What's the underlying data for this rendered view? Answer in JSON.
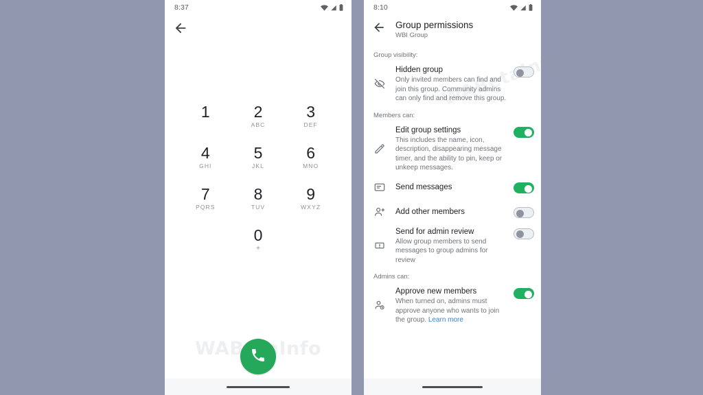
{
  "left_phone": {
    "status_bar": {
      "time": "8:37",
      "icons": [
        "wifi-icon",
        "signal-icon",
        "battery-icon"
      ]
    },
    "back_button": "back-arrow-icon",
    "watermark": "WABetaInfo",
    "keypad": [
      {
        "num": "1",
        "sub": ""
      },
      {
        "num": "2",
        "sub": "ABC"
      },
      {
        "num": "3",
        "sub": "DEF"
      },
      {
        "num": "4",
        "sub": "GHI"
      },
      {
        "num": "5",
        "sub": "JKL"
      },
      {
        "num": "6",
        "sub": "MNO"
      },
      {
        "num": "7",
        "sub": "PQRS"
      },
      {
        "num": "8",
        "sub": "TUV"
      },
      {
        "num": "9",
        "sub": "WXYZ"
      },
      {
        "num": "0",
        "sub": "+"
      }
    ],
    "call_button": {
      "icon": "phone-icon",
      "color": "#25a85a"
    }
  },
  "right_phone": {
    "status_bar": {
      "time": "8:10",
      "icons": [
        "wifi-icon",
        "signal-icon",
        "battery-icon"
      ]
    },
    "app_bar": {
      "back": "back-arrow-icon",
      "title": "Group permissions",
      "subtitle": "WBI Group"
    },
    "watermark": "WABetaInfo",
    "sections": [
      {
        "label": "Group visibility:",
        "rows": [
          {
            "icon": "eye-off-icon",
            "title": "Hidden group",
            "desc": "Only invited members can find and join this group. Community admins can only find and remove this group.",
            "toggle": "off"
          }
        ]
      },
      {
        "label": "Members can:",
        "rows": [
          {
            "icon": "pencil-icon",
            "title": "Edit group settings",
            "desc": "This includes the name, icon, description, disappearing message timer, and the ability to pin, keep or unkeep messages.",
            "toggle": "on"
          },
          {
            "icon": "message-icon",
            "title": "Send messages",
            "desc": "",
            "toggle": "on"
          },
          {
            "icon": "person-add-icon",
            "title": "Add other members",
            "desc": "",
            "toggle": "off"
          },
          {
            "icon": "review-icon",
            "title": "Send for admin review",
            "desc": "Allow group members to send messages to group admins for review",
            "toggle": "off"
          }
        ]
      },
      {
        "label": "Admins can:",
        "rows": [
          {
            "icon": "person-approve-icon",
            "title": "Approve new members",
            "desc": "When turned on, admins must approve anyone who wants to join the group. ",
            "link": "Learn more",
            "toggle": "on"
          }
        ]
      }
    ]
  },
  "colors": {
    "background": "#9197ae",
    "accent_green": "#1fb161",
    "call_green": "#25a85a",
    "link_blue": "#3b7fd4"
  }
}
